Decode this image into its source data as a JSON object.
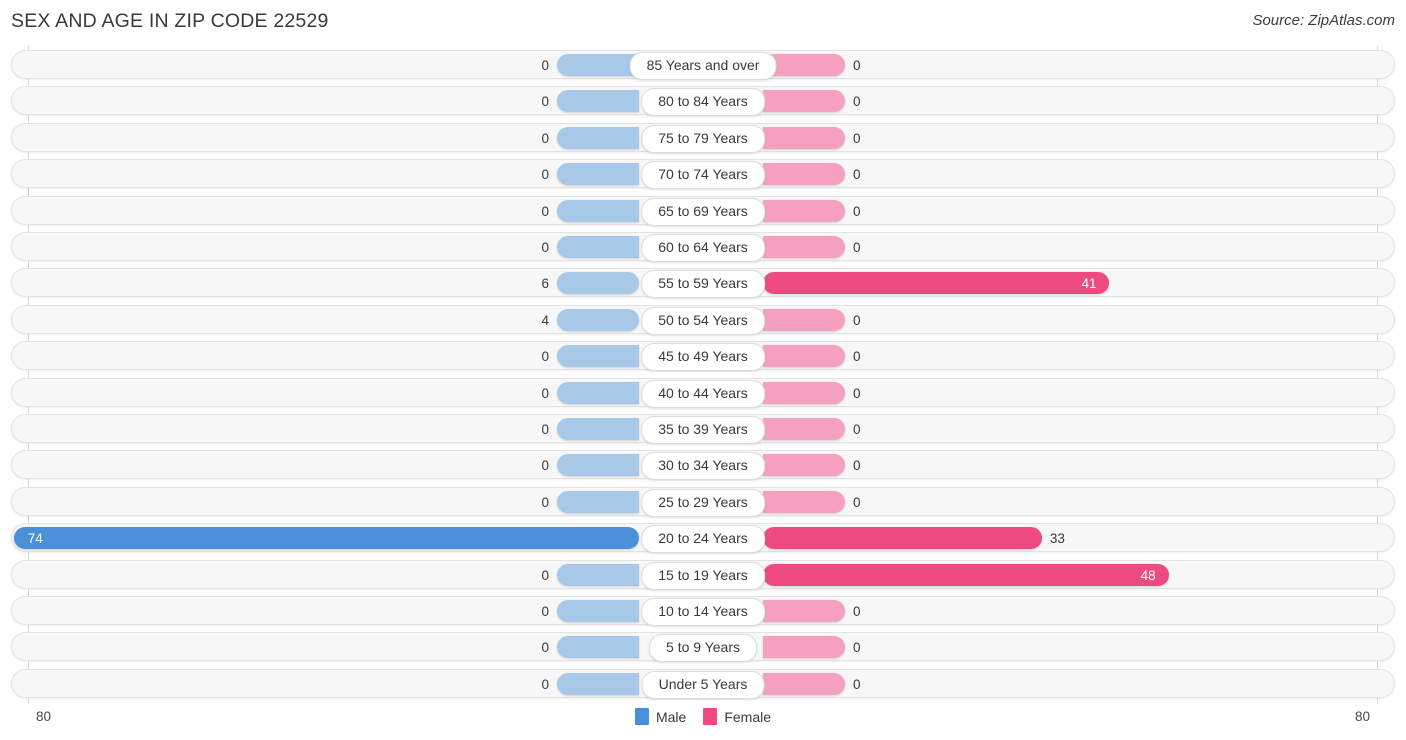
{
  "header": {
    "title": "SEX AND AGE IN ZIP CODE 22529",
    "source": "Source: ZipAtlas.com"
  },
  "legend": {
    "items": [
      {
        "label": "Male",
        "color": "#4a90d9"
      },
      {
        "label": "Female",
        "color": "#ed4a82"
      }
    ]
  },
  "axis": {
    "left_label": "80",
    "right_label": "80",
    "max": 80
  },
  "colors": {
    "male_strong": "#4a90d9",
    "male_light": "#a8c8e8",
    "female_strong": "#ed4a82",
    "female_light": "#f5a0bf",
    "row_background": "#f7f7f7",
    "row_border": "#e3e3e3"
  },
  "chart_data": {
    "type": "bar",
    "title": "SEX AND AGE IN ZIP CODE 22529",
    "subtitle": "Source: ZipAtlas.com",
    "orientation": "horizontal-diverging",
    "xlabel": "",
    "ylabel": "",
    "xlim": [
      -80,
      80
    ],
    "grid": false,
    "legend_position": "bottom-center",
    "categories": [
      "85 Years and over",
      "80 to 84 Years",
      "75 to 79 Years",
      "70 to 74 Years",
      "65 to 69 Years",
      "60 to 64 Years",
      "55 to 59 Years",
      "50 to 54 Years",
      "45 to 49 Years",
      "40 to 44 Years",
      "35 to 39 Years",
      "30 to 34 Years",
      "25 to 29 Years",
      "20 to 24 Years",
      "15 to 19 Years",
      "10 to 14 Years",
      "5 to 9 Years",
      "Under 5 Years"
    ],
    "series": [
      {
        "name": "Male",
        "color": "#4a90d9",
        "values": [
          0,
          0,
          0,
          0,
          0,
          0,
          6,
          4,
          0,
          0,
          0,
          0,
          0,
          74,
          0,
          0,
          0,
          0
        ]
      },
      {
        "name": "Female",
        "color": "#ed4a82",
        "values": [
          0,
          0,
          0,
          0,
          0,
          0,
          41,
          0,
          0,
          0,
          0,
          0,
          0,
          33,
          48,
          0,
          0,
          0
        ]
      }
    ]
  },
  "rows": [
    {
      "label": "85 Years and over",
      "male": "0",
      "female": "0"
    },
    {
      "label": "80 to 84 Years",
      "male": "0",
      "female": "0"
    },
    {
      "label": "75 to 79 Years",
      "male": "0",
      "female": "0"
    },
    {
      "label": "70 to 74 Years",
      "male": "0",
      "female": "0"
    },
    {
      "label": "65 to 69 Years",
      "male": "0",
      "female": "0"
    },
    {
      "label": "60 to 64 Years",
      "male": "0",
      "female": "0"
    },
    {
      "label": "55 to 59 Years",
      "male": "6",
      "female": "41"
    },
    {
      "label": "50 to 54 Years",
      "male": "4",
      "female": "0"
    },
    {
      "label": "45 to 49 Years",
      "male": "0",
      "female": "0"
    },
    {
      "label": "40 to 44 Years",
      "male": "0",
      "female": "0"
    },
    {
      "label": "35 to 39 Years",
      "male": "0",
      "female": "0"
    },
    {
      "label": "30 to 34 Years",
      "male": "0",
      "female": "0"
    },
    {
      "label": "25 to 29 Years",
      "male": "0",
      "female": "0"
    },
    {
      "label": "20 to 24 Years",
      "male": "74",
      "female": "33"
    },
    {
      "label": "15 to 19 Years",
      "male": "0",
      "female": "48"
    },
    {
      "label": "10 to 14 Years",
      "male": "0",
      "female": "0"
    },
    {
      "label": "5 to 9 Years",
      "male": "0",
      "female": "0"
    },
    {
      "label": "Under 5 Years",
      "male": "0",
      "female": "0"
    }
  ]
}
